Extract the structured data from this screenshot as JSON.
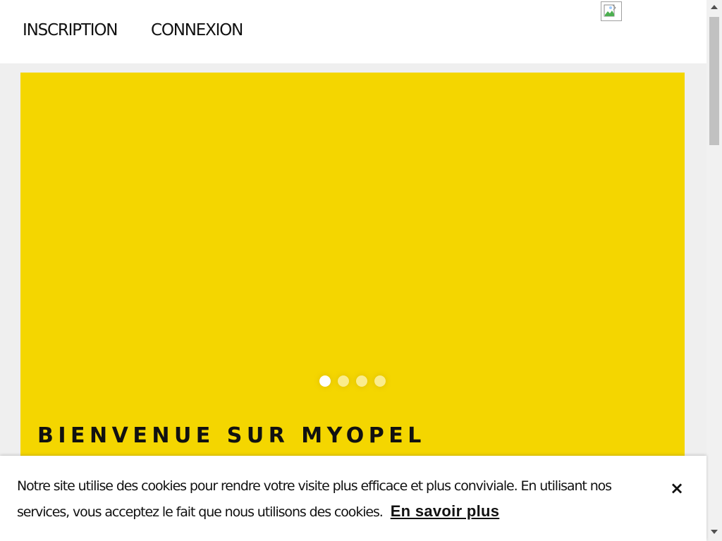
{
  "header": {
    "nav": {
      "inscription": "INSCRIPTION",
      "connexion": "CONNEXION"
    },
    "broken_image_icon": "broken-image-icon"
  },
  "hero": {
    "background_color": "#f4d600",
    "title": "BIENVENUE SUR MYOPEL",
    "carousel": {
      "slide_count": 4,
      "active_index": 0
    }
  },
  "cookie_banner": {
    "text": "Notre site utilise des cookies pour rendre votre visite plus efficace et plus conviviale. En utilisant nos services, vous acceptez le fait que nous utilisons des cookies.",
    "link_label": "En savoir plus",
    "close_label": "×"
  }
}
